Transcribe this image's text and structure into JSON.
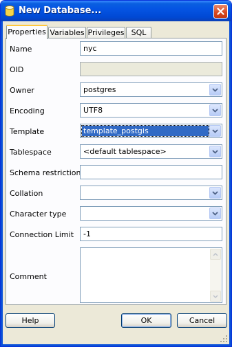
{
  "window": {
    "title": "New Database..."
  },
  "tabs": [
    {
      "label": "Properties"
    },
    {
      "label": "Variables"
    },
    {
      "label": "Privileges"
    },
    {
      "label": "SQL"
    }
  ],
  "form": {
    "name": {
      "label": "Name",
      "value": "nyc"
    },
    "oid": {
      "label": "OID",
      "value": ""
    },
    "owner": {
      "label": "Owner",
      "value": "postgres"
    },
    "encoding": {
      "label": "Encoding",
      "value": "UTF8"
    },
    "template": {
      "label": "Template",
      "value": "template_postgis"
    },
    "tablespace": {
      "label": "Tablespace",
      "value": "<default tablespace>"
    },
    "schema_restriction": {
      "label": "Schema restriction",
      "value": ""
    },
    "collation": {
      "label": "Collation",
      "value": ""
    },
    "character_type": {
      "label": "Character type",
      "value": ""
    },
    "connection_limit": {
      "label": "Connection Limit",
      "value": "-1"
    },
    "comment": {
      "label": "Comment",
      "value": ""
    }
  },
  "buttons": {
    "help": "Help",
    "ok": "OK",
    "cancel": "Cancel"
  },
  "colors": {
    "titlebar": "#0554e3",
    "selection": "#316ac5",
    "active_tab_accent": "#ffc73c"
  }
}
